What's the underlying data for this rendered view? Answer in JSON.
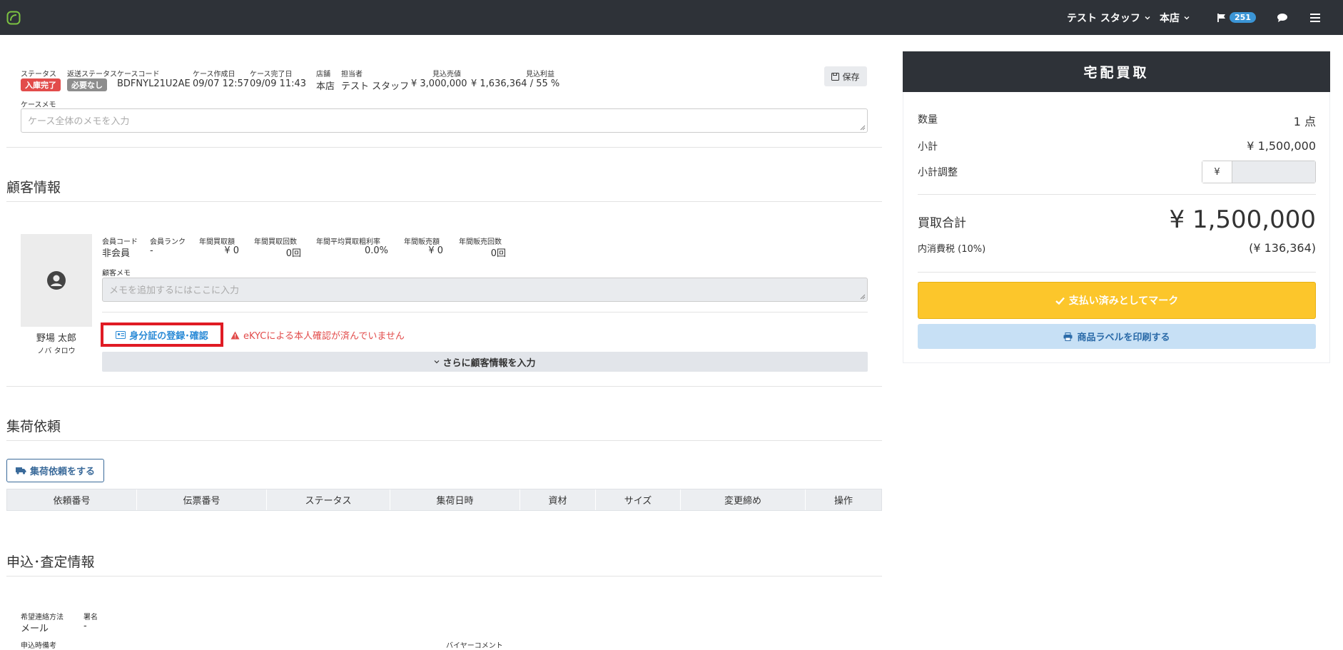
{
  "nav": {
    "staff": "テスト スタッフ",
    "store": "本店",
    "flag_count": "251"
  },
  "case": {
    "labels": {
      "status": "ステータス",
      "return_status": "返送ステータス",
      "case_code": "ケースコード",
      "created": "ケース作成日",
      "completed": "ケース完了日",
      "store": "店舗",
      "assignee": "担当者",
      "expected_sales": "見込売値",
      "expected_profit": "見込利益",
      "memo": "ケースメモ"
    },
    "status": "入庫完了",
    "return_status": "必要なし",
    "case_code": "BDFNYL21U2AE",
    "created": "09/07 12:57",
    "completed": "09/09 11:43",
    "store": "本店",
    "assignee": "テスト スタッフ",
    "expected_sales": "¥ 3,000,000",
    "expected_profit": "¥ 1,636,364 / 55 %",
    "save_label": "保存",
    "memo_placeholder": "ケース全体のメモを入力"
  },
  "customer": {
    "section_title": "顧客情報",
    "labels": {
      "member_code": "会員コード",
      "member_rank": "会員ランク",
      "annual_purchase": "年間買取額",
      "annual_purchase_count": "年間買取回数",
      "avg_margin": "年間平均買取粗利率",
      "annual_sales": "年間販売額",
      "annual_sales_count": "年間販売回数",
      "memo": "顧客メモ"
    },
    "member_code": "非会員",
    "member_rank": "-",
    "annual_purchase": "¥ 0",
    "annual_purchase_count": "0回",
    "avg_margin": "0.0%",
    "annual_sales": "¥ 0",
    "annual_sales_count": "0回",
    "memo_placeholder": "メモを追加するにはここに入力",
    "name": "野場 太郎",
    "name_kana": "ノバ タロウ",
    "id_button": "身分証の登録･確認",
    "ekyc_warning": "eKYCによる本人確認が済んでいません",
    "more_info": "さらに顧客情報を入力"
  },
  "pickup": {
    "section_title": "集荷依頼",
    "request_button": "集荷依頼をする",
    "columns": [
      "依頼番号",
      "伝票番号",
      "ステータス",
      "集荷日時",
      "資材",
      "サイズ",
      "変更締め",
      "操作"
    ]
  },
  "application": {
    "section_title": "申込･査定情報",
    "labels": {
      "contact_method": "希望連絡方法",
      "signature": "署名",
      "app_note": "申込時備考",
      "buyer_comment": "バイヤーコメント"
    },
    "contact_method": "メール",
    "signature": "-"
  },
  "summary": {
    "header": "宅配買取",
    "qty_label": "数量",
    "qty": "1 点",
    "subtotal_label": "小計",
    "subtotal": "¥ 1,500,000",
    "adjust_label": "小計調整",
    "adjust_currency": "¥",
    "total_label": "買取合計",
    "total": "¥ 1,500,000",
    "tax_label": "内消費税 (10%)",
    "tax": "(¥ 136,364)",
    "pay_button": "支払い済みとしてマーク",
    "print_button": "商品ラベルを印刷する"
  },
  "colors": {
    "navbar": "#2e3238",
    "status_red": "#e24c4b",
    "pay_yellow": "#fcc62b",
    "link_blue": "#2a8ad6",
    "highlight_red": "#e01b24"
  }
}
